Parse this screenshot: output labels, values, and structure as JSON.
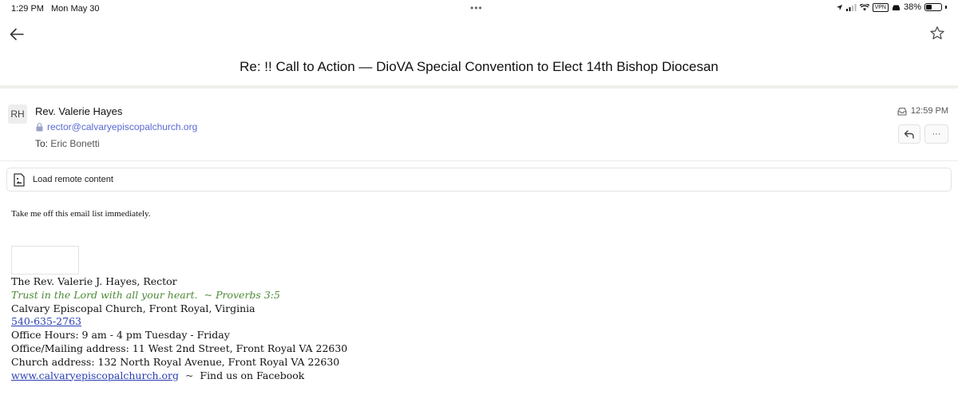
{
  "status_bar": {
    "time": "1:29 PM",
    "date": "Mon May 30",
    "dots": "•••",
    "vpn": "VPN",
    "battery_text": "38%",
    "battery_level": 0.38
  },
  "nav": {
    "back_icon": "arrow-left-icon",
    "star_icon": "star-outline-icon"
  },
  "email": {
    "subject": "Re: !! Call to Action — DioVA Special Convention to Elect 14th Bishop Diocesan",
    "sender_initials": "RH",
    "sender_name": "Rev. Valerie Hayes",
    "sender_email": "rector@calvaryepiscopalchurch.org",
    "to_label": "To:",
    "to_name": "Eric Bonetti",
    "time": "12:59 PM",
    "more_label": "···",
    "remote_content_label": "Load remote content",
    "body_text": "Take me off this email list immediately."
  },
  "signature": {
    "name_line": "The Rev. Valerie J. Hayes, Rector",
    "verse_text": "Trust in the Lord with all your heart.",
    "verse_sep": "~",
    "verse_ref": "Proverbs 3:5",
    "church_line": "Calvary Episcopal Church, Front Royal, Virginia",
    "phone": "540-635-2763",
    "office_hours": "Office Hours: 9 am - 4 pm Tuesday - Friday",
    "mailing_address": "Office/Mailing address: 11 West 2nd Street, Front Royal VA  22630",
    "church_address": "Church address: 132 North Royal Avenue, Front Royal VA 22630",
    "website": "www.calvaryepiscopalchurch.org",
    "website_sep": "~",
    "facebook": "Find us on Facebook"
  },
  "colors": {
    "link_blue": "#2a3fb3",
    "sender_email_blue": "#5a6ad3",
    "verse_green": "#4b8a34"
  }
}
